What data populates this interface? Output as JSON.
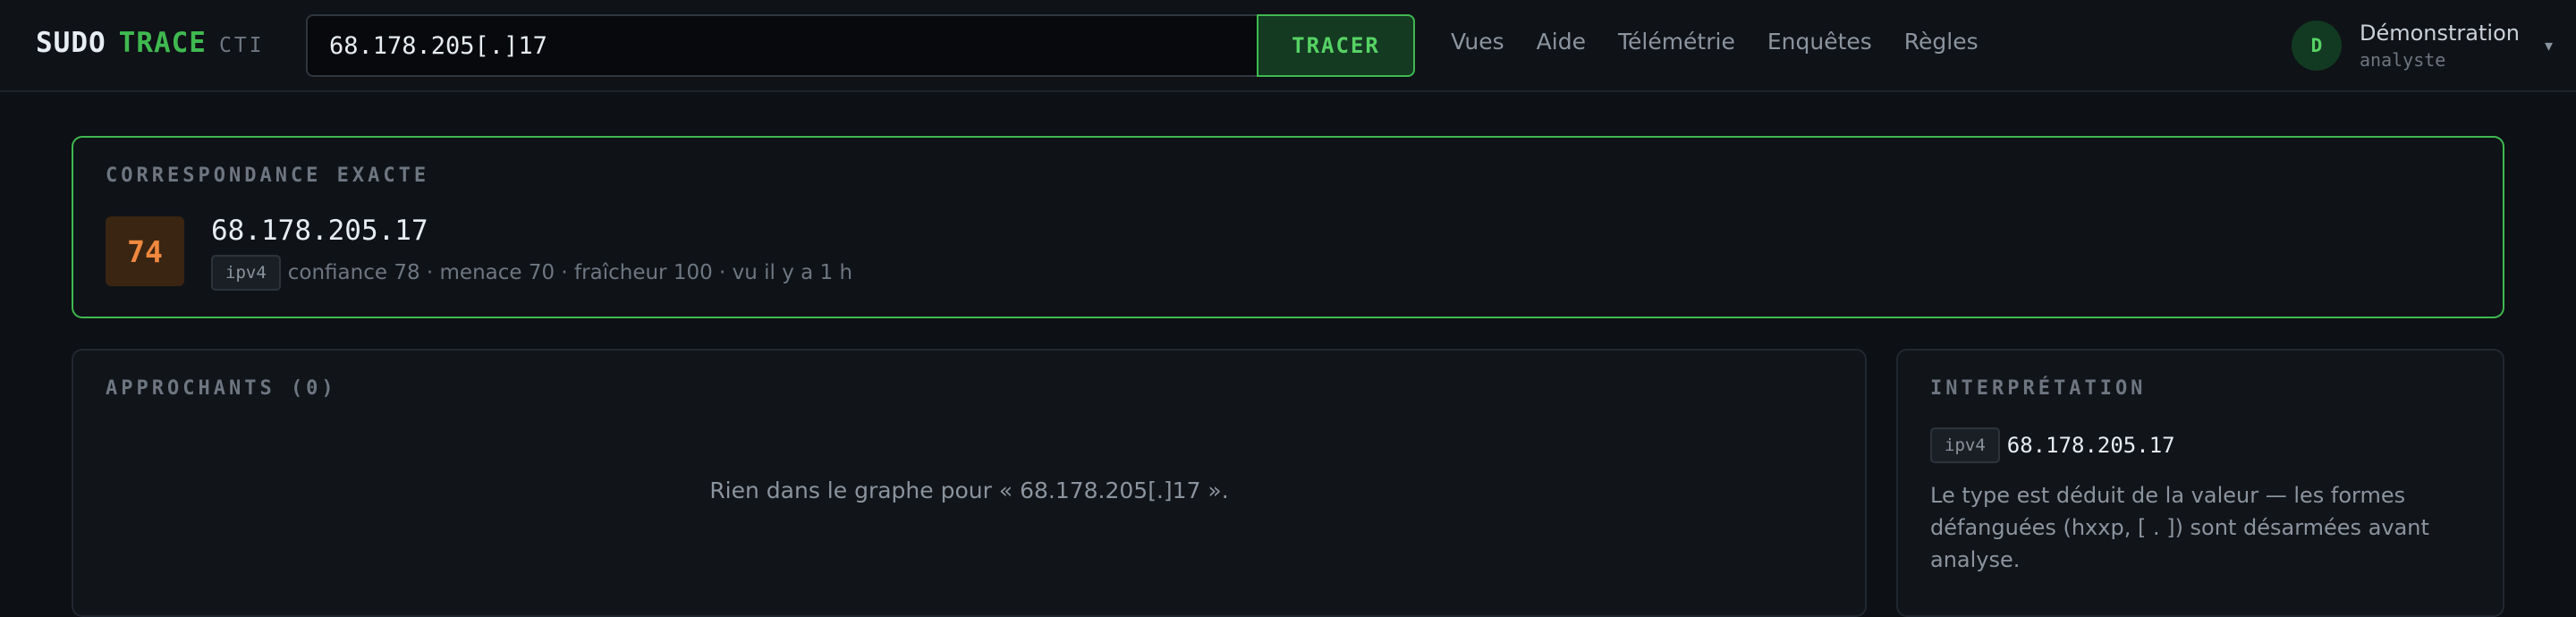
{
  "brand": {
    "sudo": "SUDO",
    "trace": "TRACE",
    "cti": "CTI"
  },
  "search": {
    "value": "68.178.205[.]17",
    "button_label": "TRACER"
  },
  "nav": [
    "Vues",
    "Aide",
    "Télémétrie",
    "Enquêtes",
    "Règles"
  ],
  "user": {
    "initial": "D",
    "name": "Démonstration",
    "role": "analyste",
    "caret": "▾"
  },
  "exact_match": {
    "title": "CORRESPONDANCE EXACTE",
    "score": "74",
    "value": "68.178.205.17",
    "type_tag": "ipv4",
    "meta": "confiance 78 · menace 70 · fraîcheur 100 · vu il y a 1 h"
  },
  "approaching": {
    "title": "APPROCHANTS (0)",
    "empty_message": "Rien dans le graphe pour « 68.178.205[.]17 »."
  },
  "interpretation": {
    "title": "INTERPRÉTATION",
    "type_tag": "ipv4",
    "value": "68.178.205.17",
    "description": "Le type est déduit de la valeur — les formes défanguées (hxxp, [ . ]) sont désarmées avant analyse."
  },
  "colors": {
    "accent": "#3fb950",
    "score_bg": "#3a2512",
    "score_fg": "#f0883e",
    "background": "#0d1014"
  }
}
